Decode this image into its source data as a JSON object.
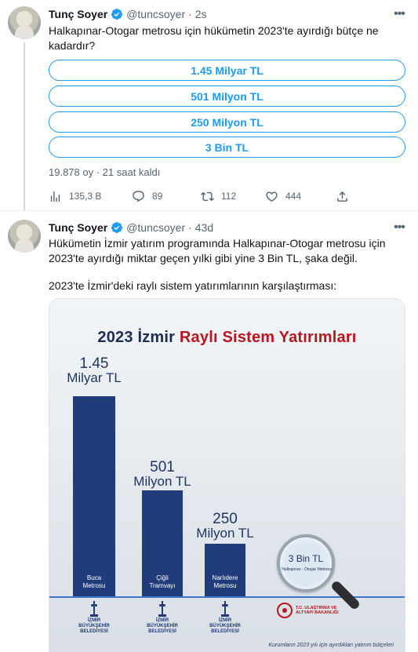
{
  "tweet1": {
    "name": "Tunç Soyer",
    "handle": "@tuncsoyer",
    "separator": "·",
    "time": "2s",
    "text": "Halkapınar-Otogar metrosu için hükümetin 2023'te ayırdığı bütçe ne kadardır?",
    "poll_options": [
      "1.45 Milyar TL",
      "501 Milyon TL",
      "250 Milyon TL",
      "3 Bin TL"
    ],
    "poll_meta": "19.878 oy · 21 saat kaldı",
    "actions": {
      "views": "135,3 B",
      "replies": "89",
      "retweets": "112",
      "likes": "444"
    }
  },
  "tweet2": {
    "name": "Tunç Soyer",
    "handle": "@tuncsoyer",
    "separator": "·",
    "time": "43d",
    "text_line1": "Hükümetin İzmir yatırım programında Halkapınar-Otogar metrosu için 2023'te ayırdığı miktar geçen yılki gibi yine 3 Bin TL, şaka değil.",
    "text_line2": "2023'te İzmir'deki raylı sistem yatırımlarının karşılaştırması:"
  },
  "icons": {
    "verified": "verified-badge-icon",
    "more": "more-dots-icon",
    "views": "bar-chart-icon",
    "reply": "reply-bubble-icon",
    "retweet": "retweet-icon",
    "like": "heart-icon",
    "share": "share-icon"
  },
  "colors": {
    "accent": "#1d9bf0",
    "bar": "#203c7a",
    "title_dark": "#1c2c54",
    "title_red": "#b8161d"
  },
  "chart_data": {
    "type": "bar",
    "title_part1": "2023 İzmir",
    "title_part2": "Raylı Sistem Yatırımları",
    "categories": [
      "Buca Metrosu",
      "Çiğli Tramvayı",
      "Narlıdere Metrosu",
      "Halkapınar - Otogar Metrosu"
    ],
    "category_lines": [
      [
        "Buca",
        "Metrosu"
      ],
      [
        "Çiğli",
        "Tramvayı"
      ],
      [
        "Narlıdere",
        "Metrosu"
      ],
      [
        "Halkapınar - Otogar Metrosu"
      ]
    ],
    "values_tl": [
      1450000000,
      501000000,
      250000000,
      3000
    ],
    "value_labels": [
      [
        "1.45",
        "Milyar TL"
      ],
      [
        "501",
        "Milyon TL"
      ],
      [
        "250",
        "Milyon TL"
      ],
      [
        "3 Bin TL"
      ]
    ],
    "logos": [
      [
        "İZMİR",
        "BÜYÜKŞEHİR",
        "BELEDİYESİ"
      ],
      [
        "İZMİR",
        "BÜYÜKŞEHİR",
        "BELEDİYESİ"
      ],
      [
        "İZMİR",
        "BÜYÜKŞEHİR",
        "BELEDİYESİ"
      ]
    ],
    "ministry": [
      "T.C. ULAŞTIRMA VE",
      "ALTYAPI BAKANLIĞI"
    ],
    "footnote": "Kurumların 2023 yılı için ayırdıkları yatırım bütçeleri"
  }
}
